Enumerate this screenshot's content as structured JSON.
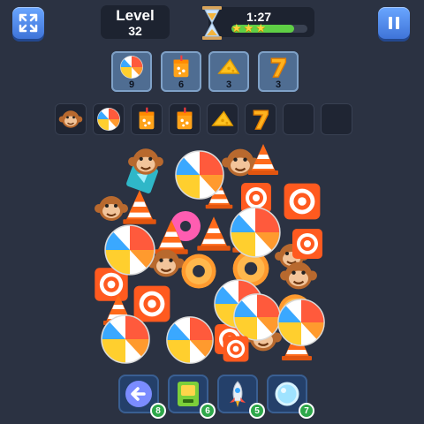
{
  "header": {
    "level_label": "Level",
    "level_number": "32",
    "timer": "1:27",
    "timer_fill_fraction": 0.82,
    "stars_earned": 3
  },
  "goals": [
    {
      "item": "beach-ball",
      "count": "9"
    },
    {
      "item": "juice-box",
      "count": "6"
    },
    {
      "item": "cheese-slice",
      "count": "3"
    },
    {
      "item": "number-seven",
      "count": "3"
    }
  ],
  "tray": {
    "capacity": 8,
    "items": [
      "monkey-face",
      "beach-ball",
      "juice-box",
      "juice-box",
      "cheese-slice",
      "number-seven"
    ]
  },
  "boosters": [
    {
      "name": "undo",
      "icon": "undo-arrow-icon",
      "count": "8"
    },
    {
      "name": "shuffle",
      "icon": "shuffle-machine-icon",
      "count": "6"
    },
    {
      "name": "rocket",
      "icon": "rocket-icon",
      "count": "5"
    },
    {
      "name": "magnifier",
      "icon": "magnifier-icon",
      "count": "7"
    }
  ],
  "colors": {
    "background": "#2b3242",
    "accent_blue": "#4d8af0",
    "goal_tile": "#4f6d92",
    "star": "#ffd23a",
    "badge_green": "#2ea84a"
  }
}
